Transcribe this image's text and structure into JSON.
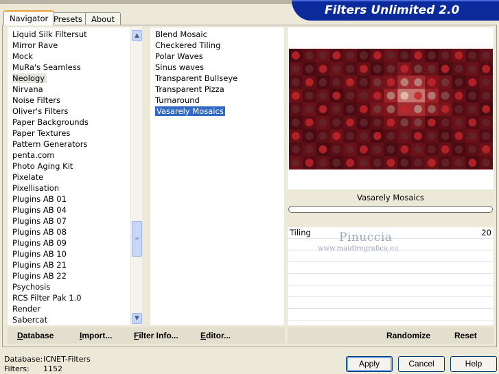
{
  "header": {
    "title": "Filters Unlimited 2.0"
  },
  "tabs": [
    {
      "label": "Navigator",
      "active": true
    },
    {
      "label": "Presets",
      "active": false
    },
    {
      "label": "About",
      "active": false
    }
  ],
  "categories": {
    "items": [
      "Liquid Silk Filtersut",
      "Mirror Rave",
      "Mock",
      "MuRa's Seamless",
      "Neology",
      "Nirvana",
      "Noise Filters",
      "Oliver's Filters",
      "Paper Backgrounds",
      "Paper Textures",
      "Pattern Generators",
      "penta.com",
      "Photo Aging Kit",
      "Pixelate",
      "Pixellisation",
      "Plugins AB 01",
      "Plugins AB 04",
      "Plugins AB 07",
      "Plugins AB 08",
      "Plugins AB 09",
      "Plugins AB 10",
      "Plugins AB 21",
      "Plugins AB 22",
      "Psychosis",
      "RCS Filter Pak 1.0",
      "Render",
      "Sabercat"
    ],
    "selected": "Neology"
  },
  "filters": {
    "items": [
      "Blend Mosaic",
      "Checkered Tiling",
      "Polar Waves",
      "Sinus waves",
      "Transparent Bullseye",
      "Transparent Pizza",
      "Turnaround",
      "Vasarely Mosaics"
    ],
    "selected": "Vasarely Mosaics"
  },
  "preview": {
    "filter_name": "Vasarely Mosaics",
    "progress": 0,
    "colors": {
      "dark": "#4a0a12",
      "mid": "#9b1b22",
      "red": "#c0262a",
      "light": "#e8c2b0"
    }
  },
  "parameters": [
    {
      "label": "Tiling",
      "value": "20"
    }
  ],
  "watermark": {
    "name": "Pinuccia",
    "url": "www.maidiregrafica.eu"
  },
  "left_buttons": [
    {
      "label": "Database",
      "underline": "D",
      "rest": "atabase"
    },
    {
      "label": "Import...",
      "underline": "I",
      "rest": "mport..."
    },
    {
      "label": "Filter Info...",
      "underline": "F",
      "rest": "ilter Info..."
    },
    {
      "label": "Editor...",
      "underline": "E",
      "rest": "ditor..."
    }
  ],
  "right_buttons": {
    "randomize": "Randomize",
    "reset": "Reset"
  },
  "status": {
    "database_label": "Database:",
    "database_value": "ICNET-Filters",
    "filters_label": "Filters:",
    "filters_value": "1152"
  },
  "dialog_buttons": {
    "apply": "Apply",
    "cancel": "Cancel",
    "help": "Help"
  }
}
